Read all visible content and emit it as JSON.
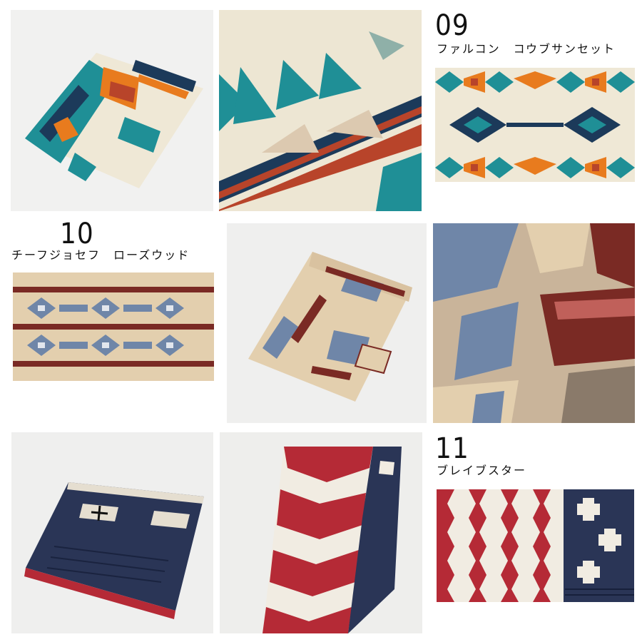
{
  "products": [
    {
      "number": "09",
      "name": "ファルコン　コウブサンセット"
    },
    {
      "number": "10",
      "name": "チーフジョセフ　ローズウッド"
    },
    {
      "number": "11",
      "name": "ブレイブスター"
    }
  ],
  "colors": {
    "falcon_cream": "#efe8d6",
    "falcon_teal": "#1f8f96",
    "falcon_navy": "#1c3a5a",
    "falcon_orange": "#e87b1e",
    "falcon_red": "#b8442a",
    "chief_tan": "#e3cfae",
    "chief_slate": "#6f86a8",
    "chief_maroon": "#7a2a24",
    "brave_red": "#b52a36",
    "brave_navy": "#2a3556",
    "brave_cream": "#f1ece2"
  }
}
